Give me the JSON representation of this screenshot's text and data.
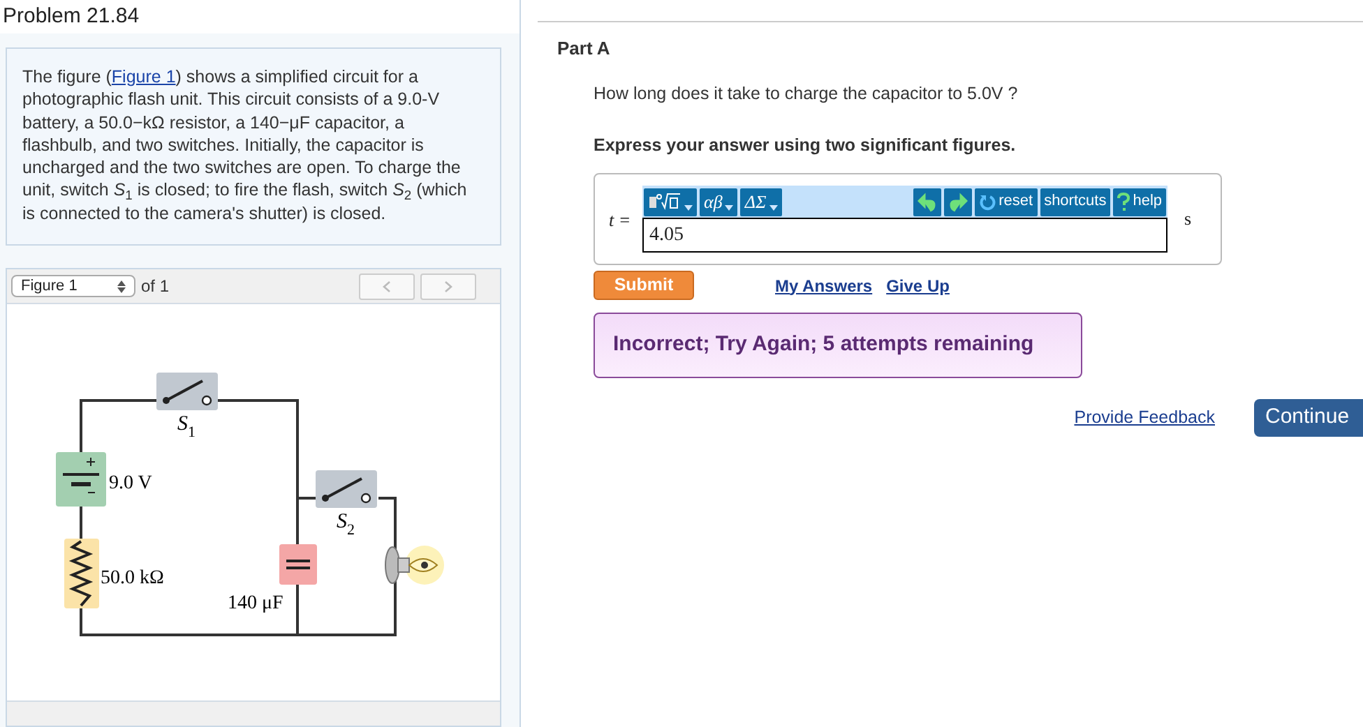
{
  "problem_title": "Problem 21.84",
  "description": {
    "before": "The figure (",
    "link": "Figure 1",
    "after": ") shows a simplified circuit for a photographic flash unit. This circuit consists of a 9.0-V battery, a 50.0−kΩ resistor, a 140−μF capacitor, a flashbulb, and two switches. Initially, the capacitor is uncharged and the two switches are open. To charge the unit, switch *S*$_{1}$ is closed; to fire the flash, switch *S*$_{2}$ (which is connected to the camera's shutter) is closed."
  },
  "figure_viewer": {
    "selector": "Figure 1",
    "count": "of 1",
    "prev_disabled": true,
    "next_disabled": true
  },
  "circuit": {
    "labels": [
      {
        "kind": "switch",
        "text": "S",
        "sub": "1"
      },
      {
        "kind": "battery",
        "text": "9.0 V"
      },
      {
        "kind": "resistor",
        "text": "50.0 kΩ"
      },
      {
        "kind": "capacitor",
        "text": "140 μF"
      },
      {
        "kind": "switch",
        "text": "S",
        "sub": "2"
      }
    ]
  },
  "part": {
    "title": "Part A",
    "question": "How long does it take to charge the capacitor to 5.0V ?",
    "instruction": "Express your answer using two significant figures.",
    "answer": {
      "variable": "t =",
      "value": "4.05",
      "unit": "s",
      "toolbar": [
        {
          "kind": "template",
          "caret": true
        },
        {
          "kind": "text",
          "text": "αβ",
          "caret": true
        },
        {
          "kind": "text",
          "text": "ΔΣ",
          "caret": true
        },
        {
          "kind": "undo"
        },
        {
          "kind": "redo"
        },
        {
          "kind": "reset",
          "text": "reset"
        },
        {
          "kind": "text",
          "text": "shortcuts"
        },
        {
          "kind": "help",
          "text": "help"
        }
      ]
    },
    "submit": "Submit",
    "links": [
      "My Answers",
      "Give Up"
    ],
    "feedback": "Incorrect; Try Again; 5 attempts remaining"
  },
  "footer": {
    "feedback_link": "Provide Feedback",
    "continue": "Continue"
  }
}
